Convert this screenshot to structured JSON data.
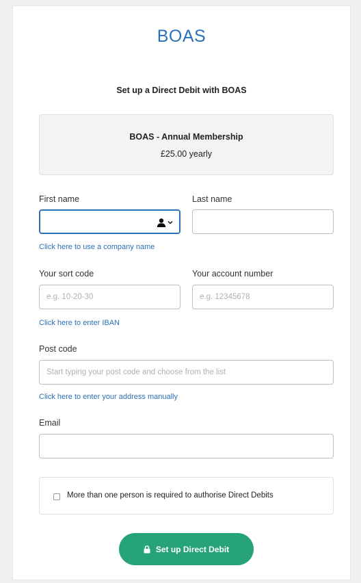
{
  "brand": {
    "name": "BOAS",
    "color": "#2a6fb8"
  },
  "page": {
    "subtitle": "Set up a Direct Debit with BOAS"
  },
  "plan": {
    "name": "BOAS - Annual Membership",
    "price": "£25.00 yearly"
  },
  "fields": {
    "first_name": {
      "label": "First name",
      "value": "",
      "placeholder": ""
    },
    "last_name": {
      "label": "Last name",
      "value": "",
      "placeholder": ""
    },
    "sort_code": {
      "label": "Your sort code",
      "value": "",
      "placeholder": "e.g. 10-20-30"
    },
    "account_number": {
      "label": "Your account number",
      "value": "",
      "placeholder": "e.g. 12345678"
    },
    "post_code": {
      "label": "Post code",
      "value": "",
      "placeholder": "Start typing your post code and choose from the list"
    },
    "email": {
      "label": "Email",
      "value": "",
      "placeholder": ""
    }
  },
  "links": {
    "company_name": "Click here to use a company name",
    "iban": "Click here to enter IBAN",
    "address_manual": "Click here to enter your address manually"
  },
  "checkbox": {
    "label": "More than one person is required to authorise Direct Debits",
    "checked": false
  },
  "submit": {
    "label": "Set up Direct Debit",
    "icon": "lock-icon",
    "color": "#27a37a"
  },
  "icons": {
    "first_name_adornment": "person-chevron-icon"
  }
}
